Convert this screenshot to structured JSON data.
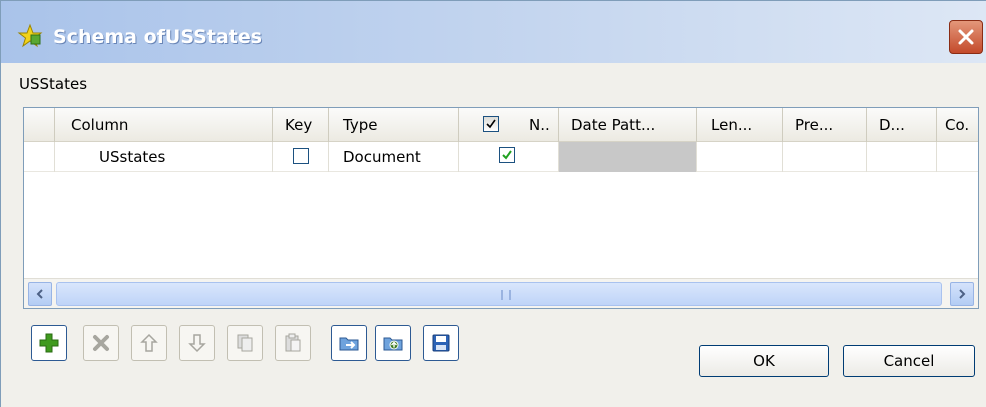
{
  "window": {
    "title": "Schema ofUSStates"
  },
  "group": {
    "label": "USStates"
  },
  "table": {
    "columns": [
      {
        "label": "Column"
      },
      {
        "label": "Key"
      },
      {
        "label": "Type"
      },
      {
        "label": "N.."
      },
      {
        "label": "Date Patt..."
      },
      {
        "label": "Len..."
      },
      {
        "label": "Pre..."
      },
      {
        "label": "D..."
      },
      {
        "label": "Co."
      }
    ],
    "rows": [
      {
        "column": "USstates",
        "key": false,
        "type": "Document",
        "nullable": true,
        "date_pattern": "",
        "length": "",
        "precision": "",
        "default": "",
        "comment": ""
      }
    ]
  },
  "toolbar": {
    "buttons": [
      {
        "name": "add",
        "enabled": true
      },
      {
        "name": "remove",
        "enabled": false
      },
      {
        "name": "move-up",
        "enabled": false
      },
      {
        "name": "move-down",
        "enabled": false
      },
      {
        "name": "copy",
        "enabled": false
      },
      {
        "name": "paste",
        "enabled": false
      },
      {
        "name": "import",
        "enabled": true
      },
      {
        "name": "export",
        "enabled": true
      },
      {
        "name": "save",
        "enabled": true
      }
    ]
  },
  "buttons": {
    "ok": "OK",
    "cancel": "Cancel"
  },
  "colors": {
    "titlebar_start": "#a9c3ea",
    "close": "#c44a2b",
    "add_green": "#3f9a1e",
    "date_cell": "#c8c8c8"
  }
}
